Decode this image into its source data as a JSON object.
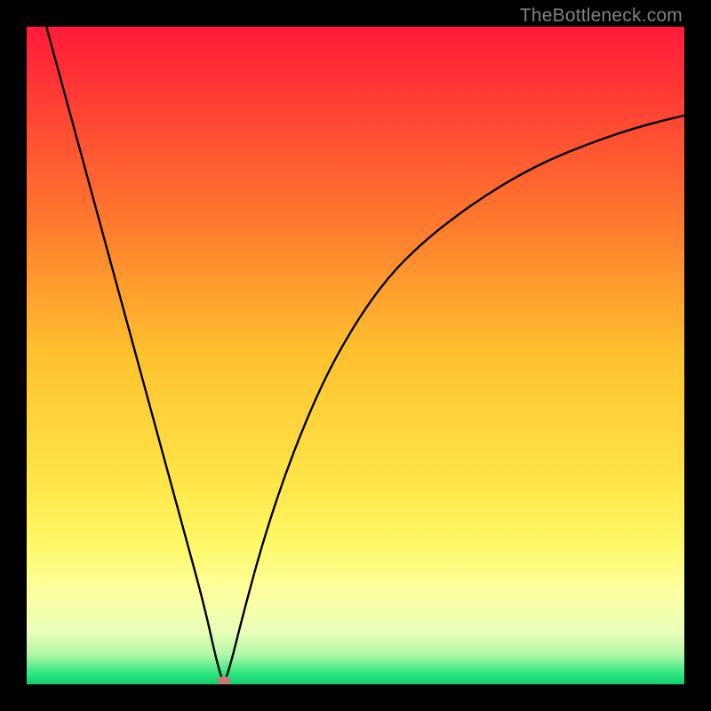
{
  "watermark": "TheBottleneck.com",
  "colors": {
    "frame": "#000000",
    "top": "#ff1a3b",
    "mid_upper": "#ff8c2e",
    "mid": "#ffd931",
    "mid_lower": "#fffb6a",
    "near_bottom": "#f3ffb0",
    "bottom": "#28e57e",
    "curve": "#000000",
    "marker": "#c47a7a"
  },
  "chart_data": {
    "type": "line",
    "title": "",
    "xlabel": "",
    "ylabel": "",
    "xlim": [
      0,
      100
    ],
    "ylim": [
      0,
      100
    ],
    "annotations": [
      {
        "text": "TheBottleneck.com",
        "position": "top-right"
      }
    ],
    "series": [
      {
        "name": "bottleneck-curve",
        "x": [
          3,
          6,
          9,
          12,
          15,
          18,
          21,
          24,
          27,
          29,
          30,
          31,
          33,
          36,
          40,
          45,
          50,
          55,
          60,
          65,
          70,
          75,
          80,
          85,
          90,
          95,
          100
        ],
        "values": [
          100,
          89,
          78,
          67,
          56,
          45,
          34,
          23,
          12,
          3,
          0,
          3,
          11,
          22,
          34,
          46,
          55,
          62,
          67,
          71,
          74.5,
          77.5,
          80,
          82,
          83.8,
          85.3,
          86.5
        ]
      }
    ],
    "marker": {
      "x": 30,
      "y": 0.6
    },
    "gradient_stops": [
      {
        "offset": 0.0,
        "color": "#ff1a3b"
      },
      {
        "offset": 0.1,
        "color": "#ff3a34"
      },
      {
        "offset": 0.3,
        "color": "#ff7a2e"
      },
      {
        "offset": 0.5,
        "color": "#ffc22e"
      },
      {
        "offset": 0.7,
        "color": "#ffe64a"
      },
      {
        "offset": 0.79,
        "color": "#fff96a"
      },
      {
        "offset": 0.86,
        "color": "#fdffa0"
      },
      {
        "offset": 0.92,
        "color": "#e9ffb8"
      },
      {
        "offset": 0.955,
        "color": "#b2f8a4"
      },
      {
        "offset": 0.985,
        "color": "#28e57e"
      },
      {
        "offset": 1.0,
        "color": "#17cd6f"
      }
    ]
  }
}
